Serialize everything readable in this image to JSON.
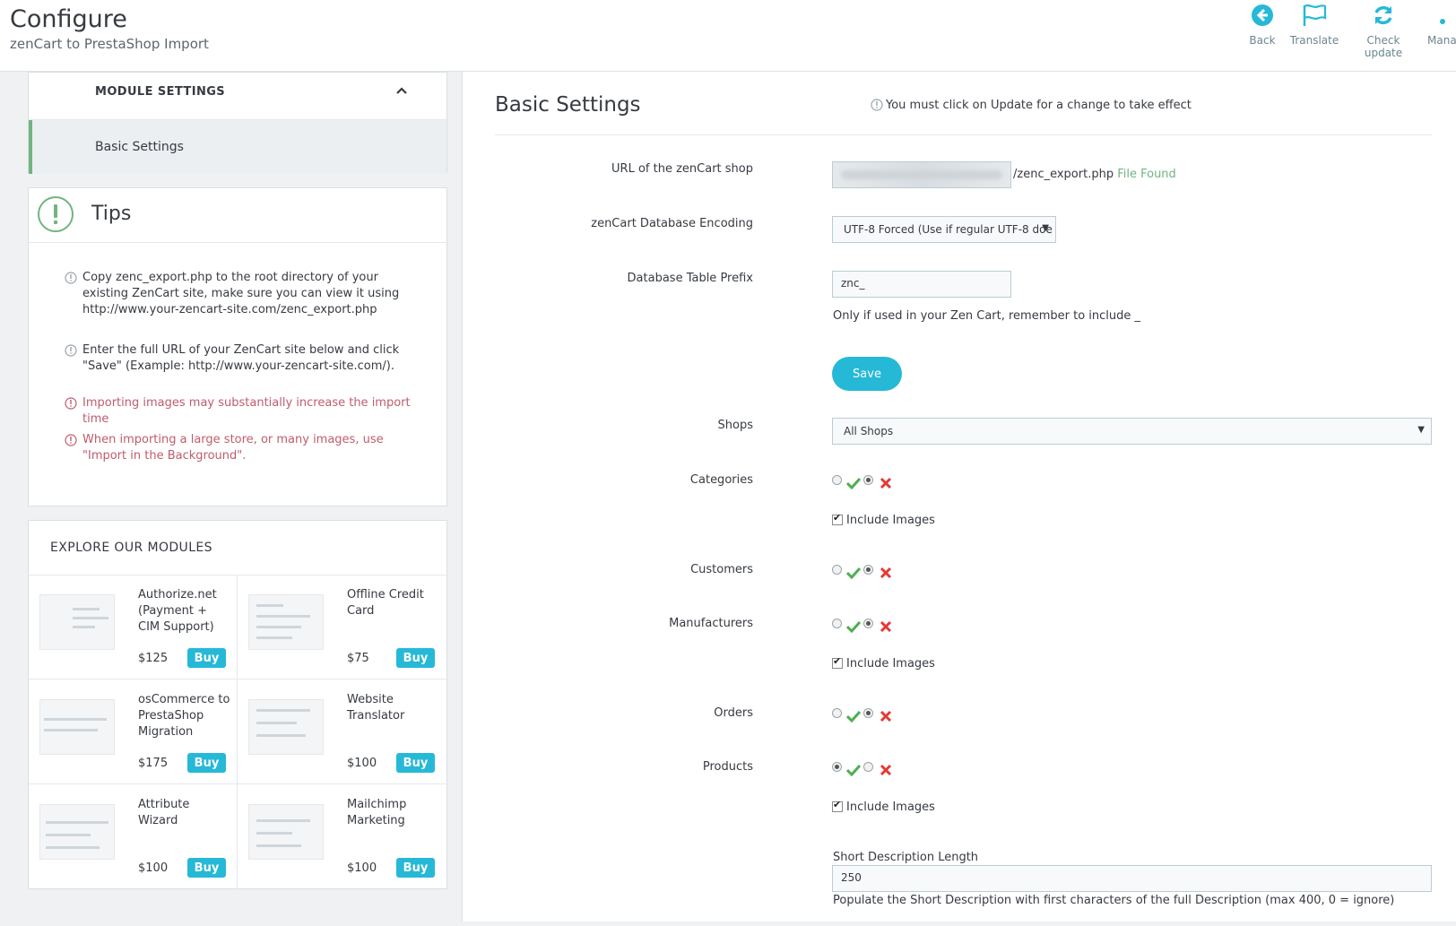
{
  "header": {
    "title": "Configure",
    "subtitle": "zenCart to PrestaShop Import",
    "toolbar": [
      {
        "label": "Back",
        "icon": "back-arrow-icon"
      },
      {
        "label": "Translate",
        "icon": "flag-icon"
      },
      {
        "label": "Check update",
        "icon": "refresh-icon"
      },
      {
        "label": "Mana",
        "icon": "manage-icon"
      }
    ]
  },
  "sidebar": {
    "module_settings": {
      "title": "MODULE SETTINGS",
      "items": [
        "Basic Settings"
      ]
    },
    "tips": {
      "title": "Tips",
      "items": [
        {
          "text": "Copy zenc_export.php to the root directory of your existing ZenCart site, make sure you can view it using http://www.your-zencart-site.com/zenc_export.php",
          "type": "info"
        },
        {
          "text": "Enter the full URL of your ZenCart site below and click \"Save\" (Example: http://www.your-zencart-site.com/).",
          "type": "info"
        },
        {
          "text": "Importing images may substantially increase the import time",
          "type": "warning"
        },
        {
          "text": "When importing a large store, or many images, use \"Import in the Background\".",
          "type": "warning"
        }
      ]
    },
    "explore": {
      "title": "EXPLORE OUR MODULES",
      "buy_label": "Buy",
      "modules": [
        {
          "name": "Authorize.net (Payment + CIM Support)",
          "price": "$125"
        },
        {
          "name": "Offline Credit Card",
          "price": "$75"
        },
        {
          "name": "osCommerce to PrestaShop Migration",
          "price": "$175"
        },
        {
          "name": "Website Translator",
          "price": "$100"
        },
        {
          "name": "Attribute Wizard",
          "price": "$100"
        },
        {
          "name": "Mailchimp Marketing",
          "price": "$100"
        }
      ]
    }
  },
  "main": {
    "title": "Basic Settings",
    "notice": "You must click on Update for a change to take effect",
    "url": {
      "label": "URL of the zenCart shop",
      "suffix": "/zenc_export.php",
      "status": "File Found"
    },
    "encoding": {
      "label": "zenCart Database Encoding",
      "value": "UTF-8 Forced (Use if regular UTF-8 doe"
    },
    "prefix": {
      "label": "Database Table Prefix",
      "value": "znc_",
      "help": "Only if used in your Zen Cart, remember to include _"
    },
    "save_label": "Save",
    "shops": {
      "label": "Shops",
      "value": "All Shops"
    },
    "categories": {
      "label": "Categories",
      "enabled": false,
      "include_images_label": "Include Images",
      "include_images": true
    },
    "customers": {
      "label": "Customers",
      "enabled": false
    },
    "manufacturers": {
      "label": "Manufacturers",
      "enabled": false,
      "include_images_label": "Include Images",
      "include_images": true
    },
    "orders": {
      "label": "Orders",
      "enabled": false
    },
    "products": {
      "label": "Products",
      "enabled": true,
      "include_images_label": "Include Images",
      "include_images": true
    },
    "short_desc": {
      "label": "Short Description Length",
      "value": "250",
      "help": "Populate the Short Description with first characters of the full Description (max 400, 0 = ignore)"
    }
  },
  "colors": {
    "accent": "#25b9d7",
    "success": "#70b580",
    "warning": "#c05c6c"
  }
}
